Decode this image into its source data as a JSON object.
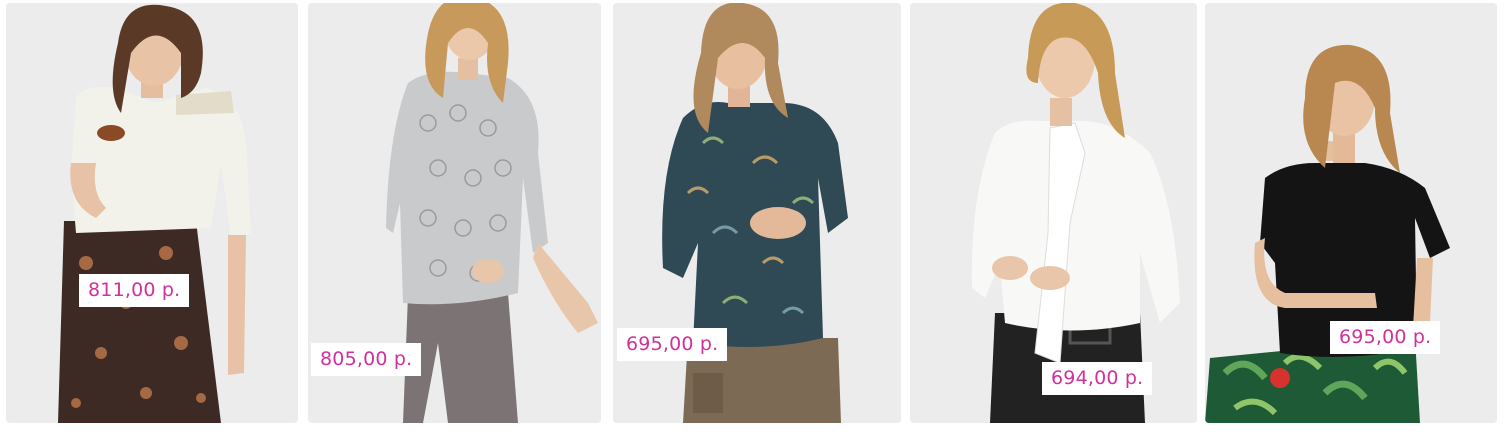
{
  "products": [
    {
      "image": "woman-in-white-lace-yoke-blouse-and-floral-skirt",
      "price": "811,00 р.",
      "colors": {
        "top": "#f3f2ea",
        "bottom": "#3e2a24",
        "hair": "#5a3a26"
      }
    },
    {
      "image": "woman-in-grey-patterned-tunic-blouse-and-taupe-trousers",
      "price": "805,00 р.",
      "colors": {
        "top": "#c9cacc",
        "bottom": "#7c7474",
        "hair": "#c79a5c"
      }
    },
    {
      "image": "woman-in-navy-green-floral-chiffon-blouse-and-khaki-cargo-trousers",
      "price": "695,00 р.",
      "colors": {
        "top": "#2f4a55",
        "bottom": "#7d6a55",
        "hair": "#b08a5c"
      }
    },
    {
      "image": "woman-in-white-pussy-bow-blouse-and-black-skirt",
      "price": "694,00 р.",
      "colors": {
        "top": "#f8f8f6",
        "bottom": "#222222",
        "hair": "#c89a58"
      }
    },
    {
      "image": "woman-in-black-tee-and-tropical-print-trousers",
      "price": "695,00 р.",
      "colors": {
        "top": "#141414",
        "bottom": "#1f5a36",
        "hair": "#b88850"
      }
    }
  ],
  "accent_color": "#d0319a"
}
